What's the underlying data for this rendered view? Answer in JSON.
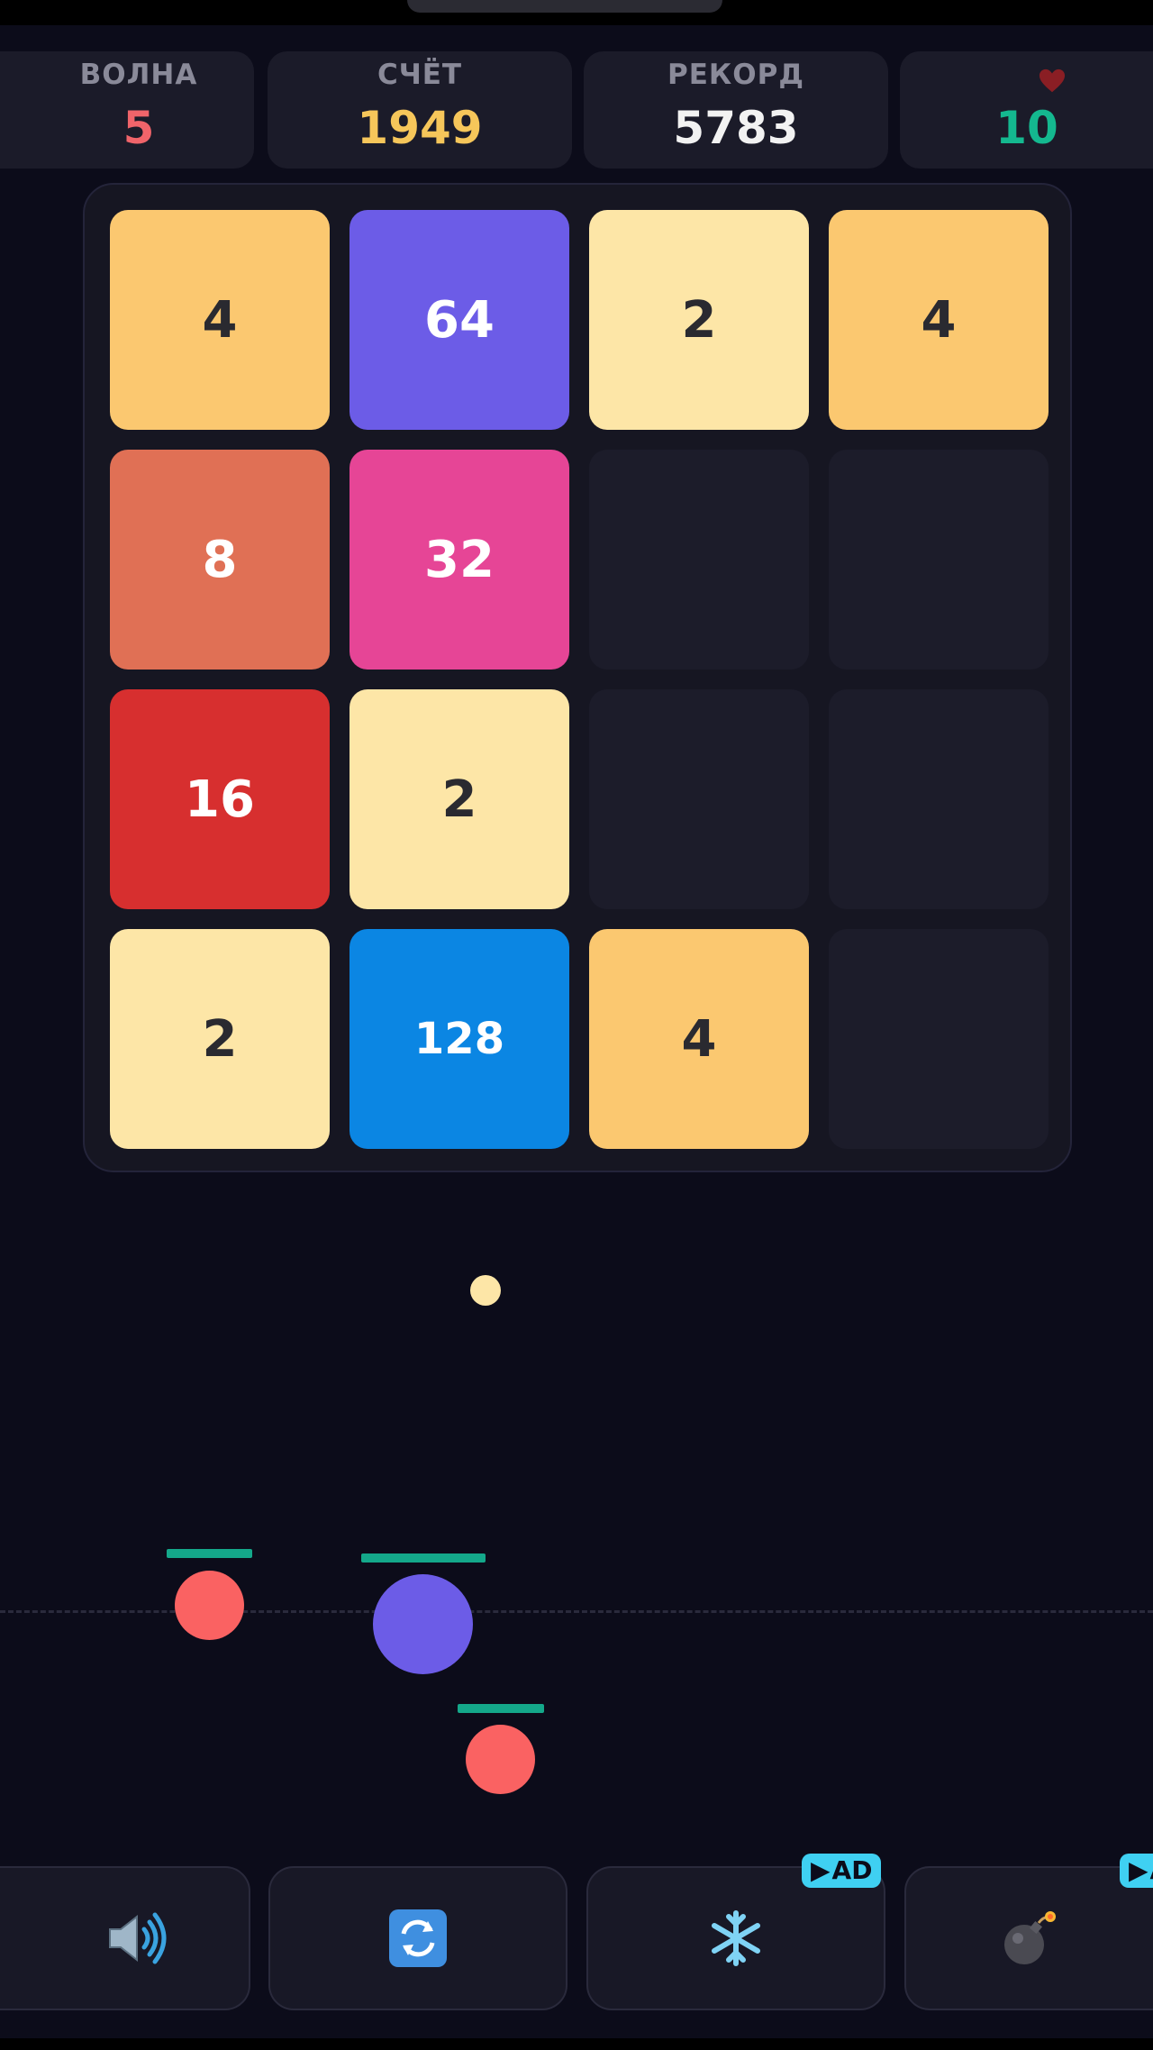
{
  "stats": {
    "wave": {
      "label": "ВОЛНА",
      "value": "5",
      "color": "#f0646a"
    },
    "score": {
      "label": "СЧЁТ",
      "value": "1949",
      "color": "#f6c65a"
    },
    "record": {
      "label": "РЕКОРД",
      "value": "5783",
      "color": "#f2f2f2"
    },
    "lives": {
      "label_icon": "heart-icon",
      "value": "10",
      "color": "#14b88f"
    }
  },
  "board": {
    "rows": [
      [
        "4",
        "64",
        "2",
        "4"
      ],
      [
        "8",
        "32",
        "",
        ""
      ],
      [
        "16",
        "2",
        "",
        ""
      ],
      [
        "2",
        "128",
        "4",
        ""
      ]
    ],
    "tile_colors": {
      "2": {
        "bg": "#fde6a7",
        "fg": "#2a2a30"
      },
      "4": {
        "bg": "#fbc870",
        "fg": "#2a2a30"
      },
      "8": {
        "bg": "#e07055",
        "fg": "#ffffff"
      },
      "16": {
        "bg": "#d72f2f",
        "fg": "#ffffff"
      },
      "32": {
        "bg": "#e64596",
        "fg": "#ffffff"
      },
      "64": {
        "bg": "#6c5ce7",
        "fg": "#ffffff"
      },
      "128": {
        "bg": "#0b86e3",
        "fg": "#ffffff"
      }
    }
  },
  "field": {
    "projectile": {
      "color": "#fde6a7"
    },
    "enemies": [
      {
        "name": "enemy-red-left",
        "color": "#fa6262",
        "health_fraction": 1.0
      },
      {
        "name": "enemy-purple",
        "color": "#6c5ce7",
        "health_fraction": 1.0
      },
      {
        "name": "enemy-red-lower",
        "color": "#fa6262",
        "health_fraction": 1.0
      }
    ],
    "health_bar_color": "#14a88a"
  },
  "controls": [
    {
      "name": "sound-button",
      "icon": "speaker-icon",
      "ad": false
    },
    {
      "name": "restart-button",
      "icon": "refresh-icon",
      "ad": false
    },
    {
      "name": "freeze-button",
      "icon": "snowflake-icon",
      "ad": true,
      "ad_label": "AD"
    },
    {
      "name": "bomb-button",
      "icon": "bomb-icon",
      "ad": true,
      "ad_label": "AD"
    }
  ]
}
